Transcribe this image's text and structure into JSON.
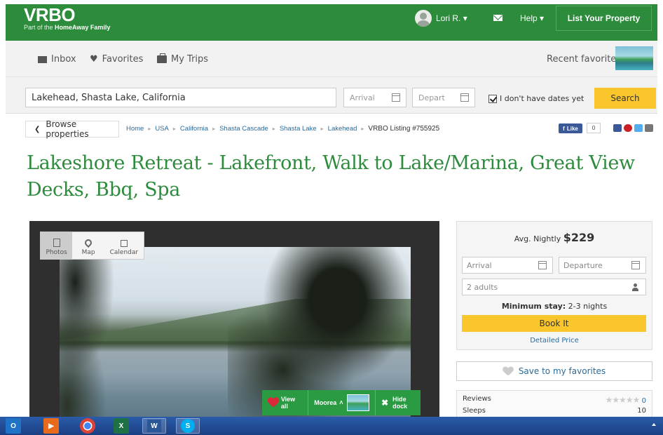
{
  "header": {
    "logo": "VRBO",
    "logo_sub_prefix": "Part of the ",
    "logo_sub_brand": "HomeAway Family",
    "user_name": "Lori R.",
    "help_label": "Help",
    "list_property_label": "List Your Property",
    "brand_color": "#2d8b3c"
  },
  "subnav": {
    "inbox": "Inbox",
    "favorites": "Favorites",
    "my_trips": "My Trips",
    "recent_favorites": "Recent favorites"
  },
  "search": {
    "location_value": "Lakehead, Shasta Lake, California",
    "arrival_placeholder": "Arrival",
    "depart_placeholder": "Depart",
    "no_dates_label": "I don't have dates yet",
    "no_dates_checked": true,
    "search_button": "Search"
  },
  "breadcrumb": {
    "browse_label": "Browse properties",
    "items": [
      "Home",
      "USA",
      "California",
      "Shasta Cascade",
      "Shasta Lake",
      "Lakehead"
    ],
    "current": "VRBO Listing #755925",
    "like_label": "Like",
    "like_count": "0"
  },
  "listing": {
    "title": "Lakeshore Retreat - Lakefront, Walk to Lake/Marina, Great View Decks, Bbq, Spa"
  },
  "viewer": {
    "tabs": [
      "Photos",
      "Map",
      "Calendar"
    ],
    "active_tab": "Photos",
    "dock_view_all": "View all",
    "dock_location": "Moorea",
    "dock_hide": "Hide dock"
  },
  "booking": {
    "avg_nightly_label": "Avg. Nightly ",
    "avg_nightly_price": "$229",
    "arrival_placeholder": "Arrival",
    "departure_placeholder": "Departure",
    "guests_value": "2 adults",
    "min_stay_label": "Minimum stay:",
    "min_stay_value": " 2-3 nights",
    "book_button": "Book It",
    "detailed_price": "Detailed Price",
    "save_favorites": "Save to my favorites",
    "accent_color": "#f9c62b"
  },
  "stats": {
    "reviews_label": "Reviews",
    "reviews_count": "0",
    "sleeps_label": "Sleeps",
    "sleeps_value": "10"
  },
  "taskbar": {
    "apps": [
      "outlook-icon",
      "media-icon",
      "chrome-icon",
      "excel-icon",
      "word-icon",
      "skype-icon"
    ]
  }
}
